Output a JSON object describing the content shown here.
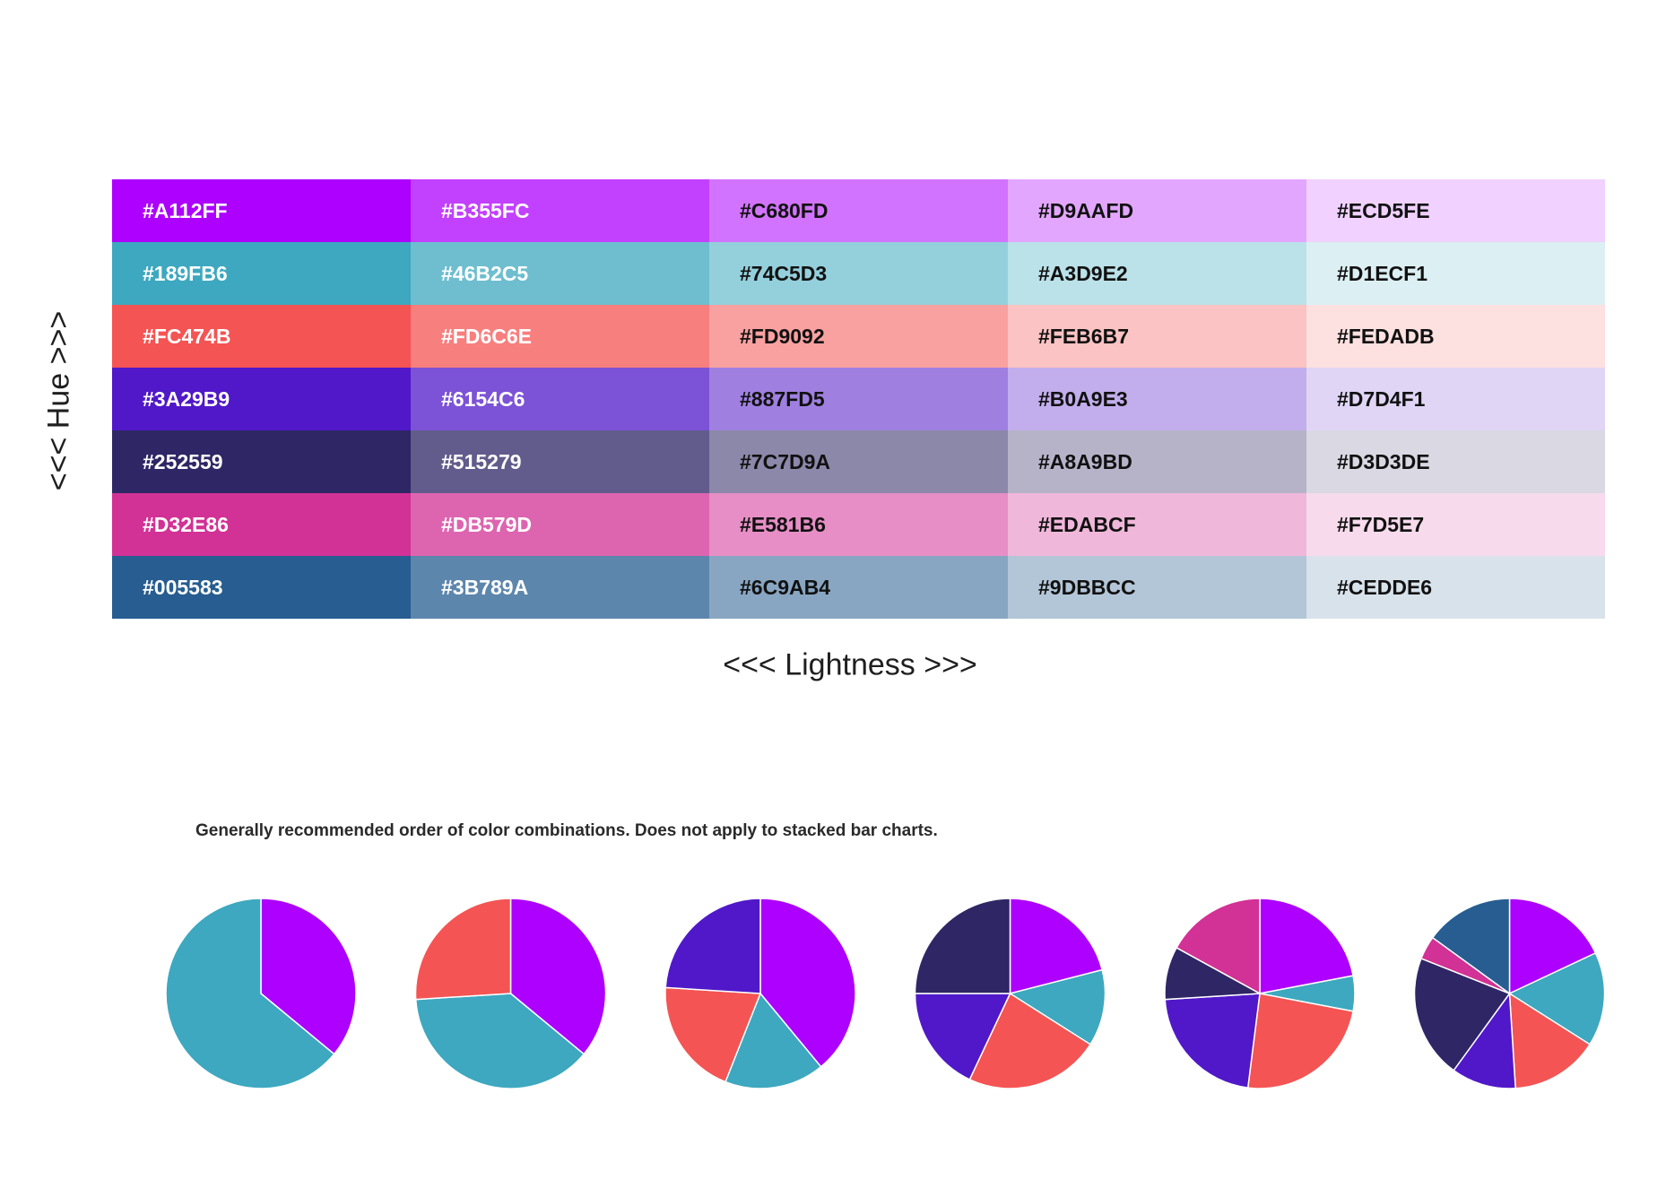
{
  "palette": {
    "rows": [
      [
        "#A112FF",
        "#B355FC",
        "#C680FD",
        "#D9AAFD",
        "#ECD5FE"
      ],
      [
        "#189FB6",
        "#46B2C5",
        "#74C5D3",
        "#A3D9E2",
        "#D1ECF1"
      ],
      [
        "#FC474B",
        "#FD6C6E",
        "#FD9092",
        "#FEB6B7",
        "#FEDADB"
      ],
      [
        "#3A29B9",
        "#6154C6",
        "#887FD5",
        "#B0A9E3",
        "#D7D4F1"
      ],
      [
        "#252559",
        "#515279",
        "#7C7D9A",
        "#A8A9BD",
        "#D3D3DE"
      ],
      [
        "#D32E86",
        "#DB579D",
        "#E581B6",
        "#EDABCF",
        "#F7D5E7"
      ],
      [
        "#005583",
        "#3B789A",
        "#6C9AB4",
        "#9DBBCC",
        "#CEDDE6"
      ]
    ],
    "dark_text_from_column": 2,
    "row_render_colors": [
      "#AD00FF",
      "#3DA8BF",
      "#F45453",
      "#5018C8",
      "#2E2665",
      "#D23195",
      "#275D90"
    ]
  },
  "labels": {
    "hue": "<<< Hue >>>",
    "lightness": "<<< Lightness >>>",
    "note": "Generally recommended order of color combinations. Does not apply to stacked bar charts."
  },
  "chart_data": {
    "type": "pie",
    "charts": [
      {
        "slices": [
          {
            "value": 36,
            "color": "#AD00FF"
          },
          {
            "value": 64,
            "color": "#3DA8BF"
          }
        ]
      },
      {
        "slices": [
          {
            "value": 36,
            "color": "#AD00FF"
          },
          {
            "value": 38,
            "color": "#3DA8BF"
          },
          {
            "value": 26,
            "color": "#F45453"
          }
        ]
      },
      {
        "slices": [
          {
            "value": 39,
            "color": "#AD00FF"
          },
          {
            "value": 17,
            "color": "#3DA8BF"
          },
          {
            "value": 20,
            "color": "#F45453"
          },
          {
            "value": 24,
            "color": "#5018C8"
          }
        ]
      },
      {
        "slices": [
          {
            "value": 21,
            "color": "#AD00FF"
          },
          {
            "value": 13,
            "color": "#3DA8BF"
          },
          {
            "value": 23,
            "color": "#F45453"
          },
          {
            "value": 18,
            "color": "#5018C8"
          },
          {
            "value": 25,
            "color": "#2E2665"
          }
        ]
      },
      {
        "slices": [
          {
            "value": 22,
            "color": "#AD00FF"
          },
          {
            "value": 6,
            "color": "#3DA8BF"
          },
          {
            "value": 24,
            "color": "#F45453"
          },
          {
            "value": 22,
            "color": "#5018C8"
          },
          {
            "value": 9,
            "color": "#2E2665"
          },
          {
            "value": 17,
            "color": "#D23195"
          }
        ]
      },
      {
        "slices": [
          {
            "value": 18,
            "color": "#AD00FF"
          },
          {
            "value": 16,
            "color": "#3DA8BF"
          },
          {
            "value": 15,
            "color": "#F45453"
          },
          {
            "value": 11,
            "color": "#5018C8"
          },
          {
            "value": 21,
            "color": "#2E2665"
          },
          {
            "value": 4,
            "color": "#D23195"
          },
          {
            "value": 15,
            "color": "#275D90"
          }
        ]
      }
    ]
  }
}
